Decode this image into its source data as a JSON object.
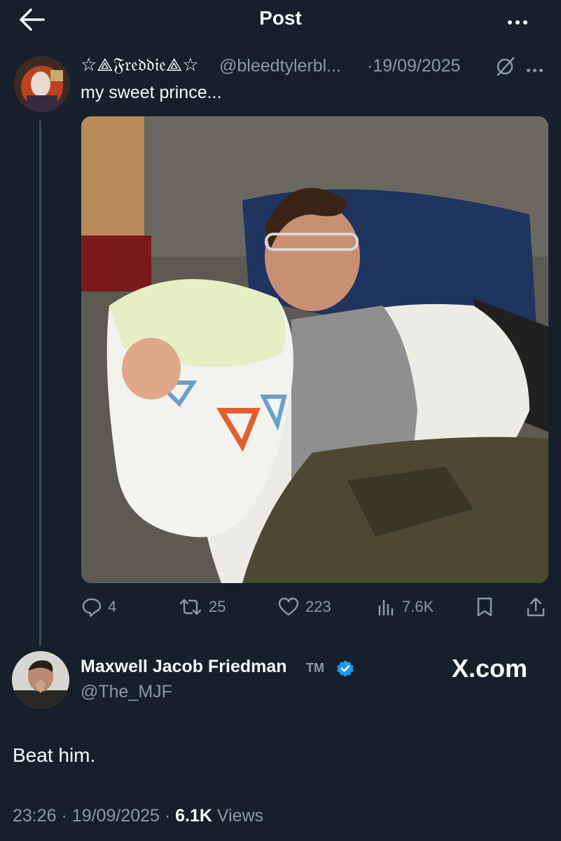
{
  "header": {
    "title": "Post",
    "back_icon": "arrow-left-icon",
    "more_icon": "more-dots-icon"
  },
  "quoted_post": {
    "display_name": "☆⟁𝔉𝔯𝔢𝔡𝔡𝔦𝔢⟁☆",
    "handle": "@bleedtylerbl...",
    "date": "19/09/2025",
    "separator": "·",
    "text": "my sweet prince...",
    "media_description": "photo",
    "actions": {
      "replies": "4",
      "reposts": "25",
      "likes": "223",
      "views": "7.6K"
    }
  },
  "main_post": {
    "display_name": "Maxwell Jacob Friedman",
    "tm": "TM",
    "verified": true,
    "handle": "@The_MJF",
    "watermark": "X.com",
    "text": "Beat him.",
    "time": "23:26",
    "date": "19/09/2025",
    "views_count": "6.1K",
    "views_label": "Views"
  },
  "colors": {
    "background": "#15202b",
    "text": "#f7f9f9",
    "muted": "#8b98a5",
    "verified": "#1d9bf0"
  }
}
